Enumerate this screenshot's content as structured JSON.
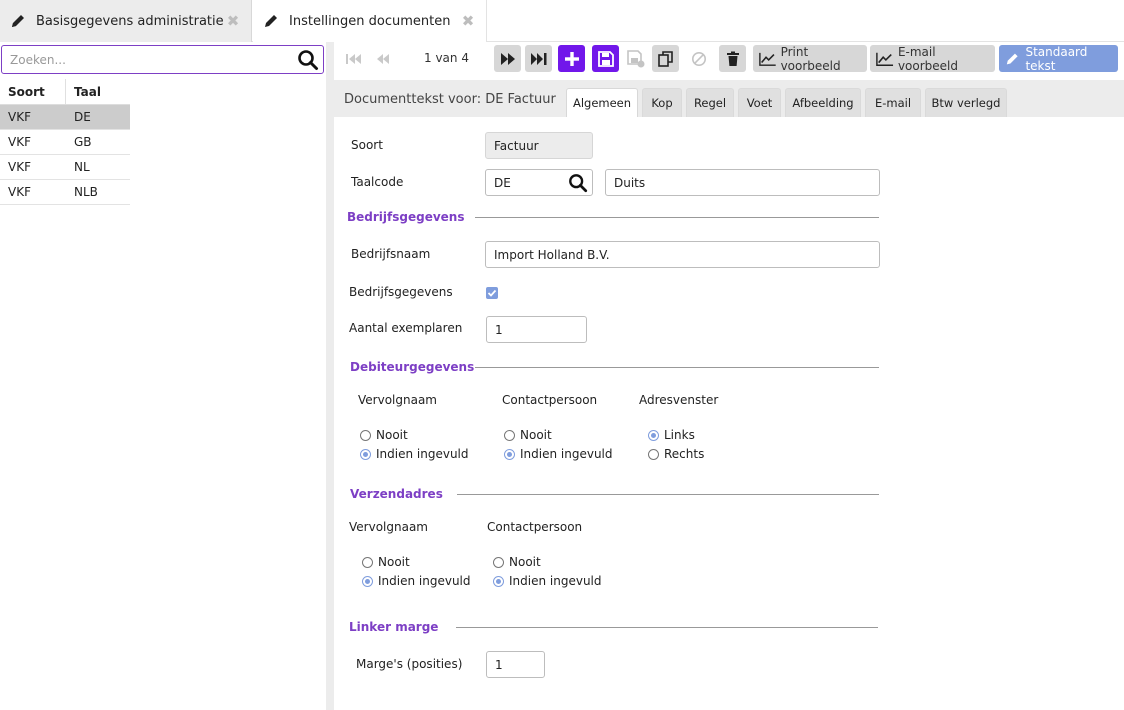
{
  "tabs": [
    {
      "label": "Basisgegevens administratie"
    },
    {
      "label": "Instellingen documenten"
    }
  ],
  "search": {
    "placeholder": "Zoeken..."
  },
  "grid": {
    "headers": [
      "Soort",
      "Taal"
    ],
    "rows": [
      {
        "soort": "VKF",
        "taal": "DE",
        "selected": true
      },
      {
        "soort": "VKF",
        "taal": "GB"
      },
      {
        "soort": "VKF",
        "taal": "NL"
      },
      {
        "soort": "VKF",
        "taal": "NLB"
      }
    ]
  },
  "toolbar": {
    "pager": "1 van 4",
    "print_preview": "Print voorbeeld",
    "email_preview": "E-mail voorbeeld",
    "standard_text": "Standaard tekst"
  },
  "doc": {
    "title": "Documenttekst voor: DE Factuur",
    "tabs": [
      "Algemeen",
      "Kop",
      "Regel",
      "Voet",
      "Afbeelding",
      "E-mail",
      "Btw verlegd"
    ],
    "active_tab": "Algemeen"
  },
  "form": {
    "soort_label": "Soort",
    "soort_value": "Factuur",
    "taalcode_label": "Taalcode",
    "taalcode_value": "DE",
    "taal_desc": "Duits",
    "sect_bedrijf": "Bedrijfsgegevens",
    "bedrijfsnaam_label": "Bedrijfsnaam",
    "bedrijfsnaam_value": "Import Holland B.V.",
    "bedrijfsgegevens_label": "Bedrijfsgegevens",
    "bedrijfsgegevens_checked": true,
    "aantal_label": "Aantal exemplaren",
    "aantal_value": "1",
    "sect_debiteur": "Debiteurgegevens",
    "deb_vervolgnaam": "Vervolgnaam",
    "deb_contactpersoon": "Contactpersoon",
    "deb_adresvenster": "Adresvenster",
    "opt_nooit": "Nooit",
    "opt_indien": "Indien ingevuld",
    "opt_links": "Links",
    "opt_rechts": "Rechts",
    "sect_verzend": "Verzendadres",
    "vz_vervolgnaam": "Vervolgnaam",
    "vz_contactpersoon": "Contactpersoon",
    "sect_marge": "Linker marge",
    "marge_label": "Marge's (posities)",
    "marge_value": "1"
  },
  "colors": {
    "accent": "#7117ea",
    "section": "#7d3fc5",
    "radio": "#7f9ddd"
  }
}
